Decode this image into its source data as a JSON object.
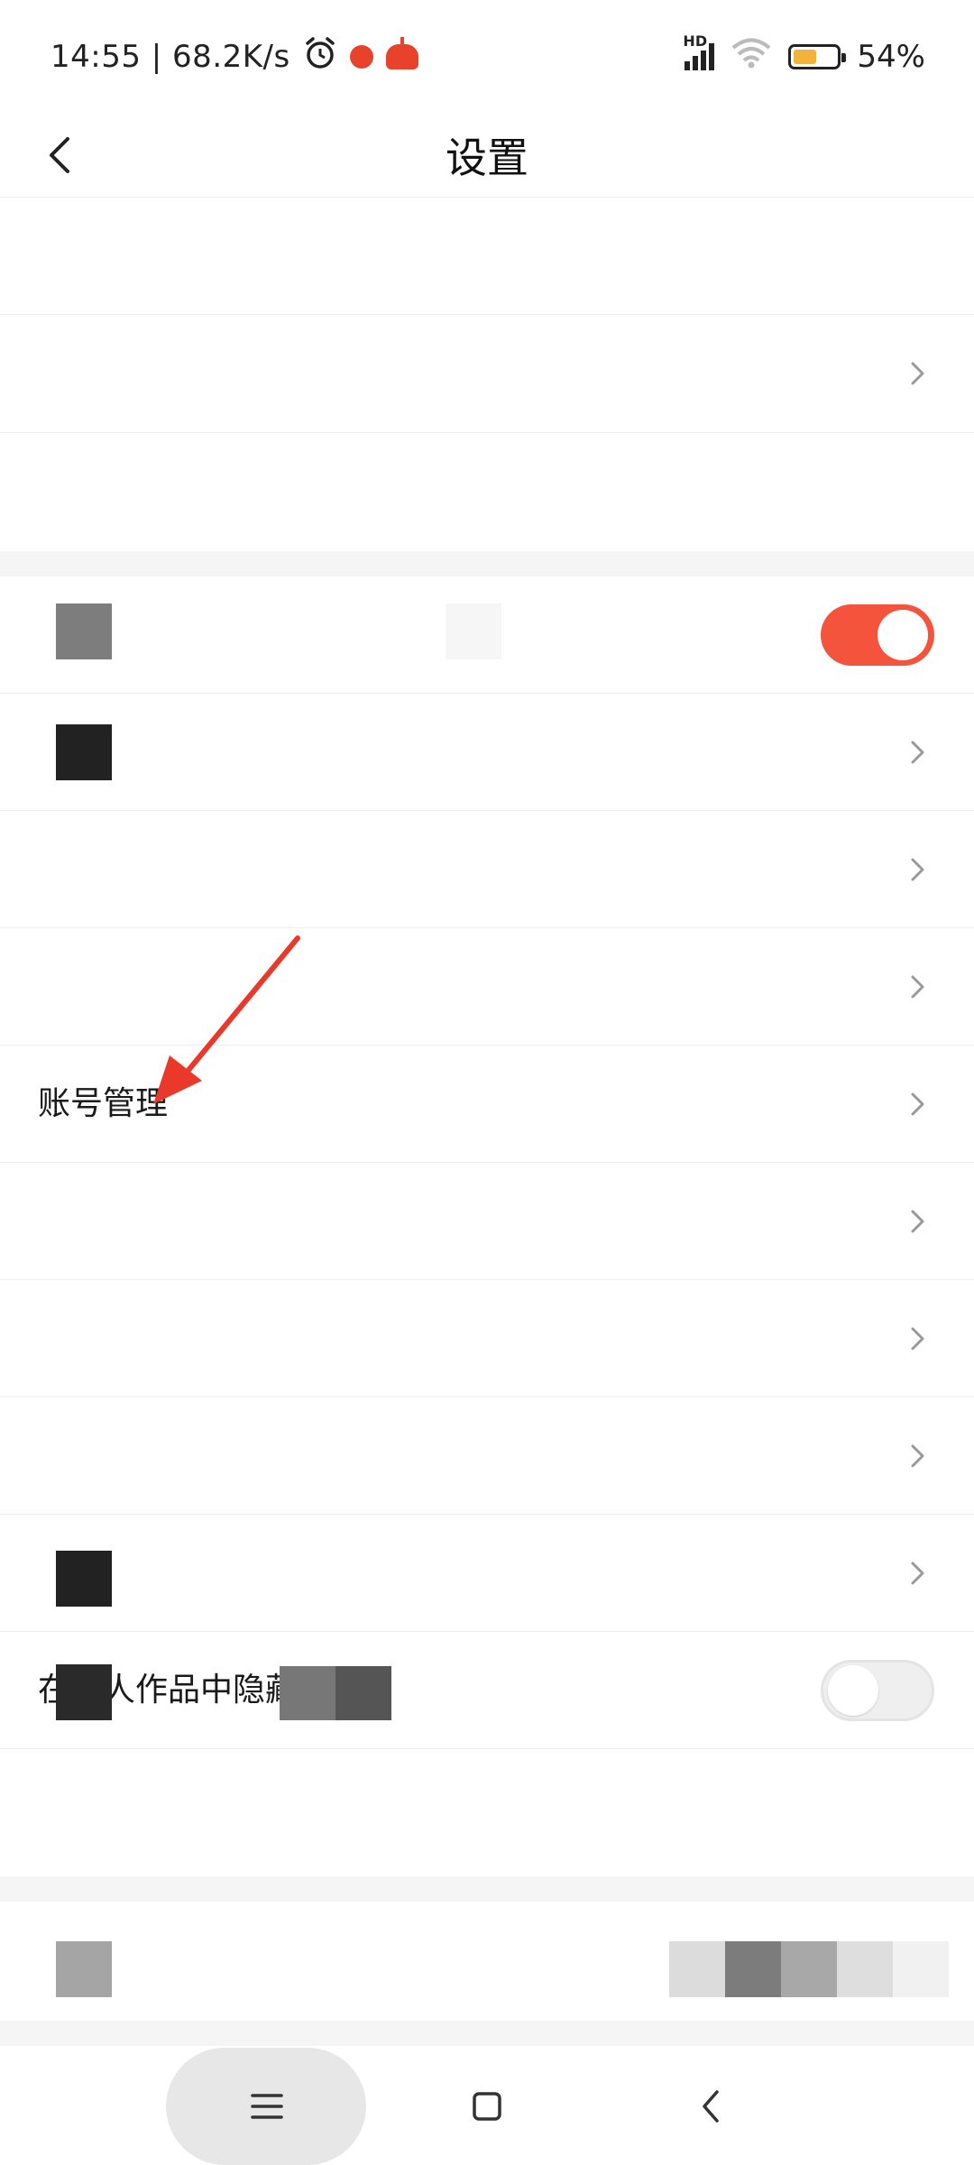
{
  "status_bar": {
    "time": "14:55 | 68.2K/s",
    "network_badge": "HD",
    "battery_percent": "54%",
    "battery_level": 0.54,
    "icons": [
      "alarm-icon",
      "red-dot-app-icon",
      "robot-app-icon",
      "signal-icon",
      "wifi-icon",
      "battery-icon"
    ]
  },
  "header": {
    "title": "设置",
    "back_icon": "chevron-left-icon"
  },
  "settings": {
    "visible_item_label": "账号管理",
    "partial_item_label": "在个人作品中隐藏广告"
  },
  "colors": {
    "accent": "#f4533c",
    "toggle_off": "#efefef",
    "annotation_arrow": "#e8392a",
    "divider": "#eeeeee",
    "band": "#f5f5f5"
  },
  "toggles": {
    "first": "on",
    "second": "off"
  },
  "nav": {
    "icons": [
      "menu-icon",
      "home-square-icon",
      "back-chevron-icon"
    ]
  }
}
